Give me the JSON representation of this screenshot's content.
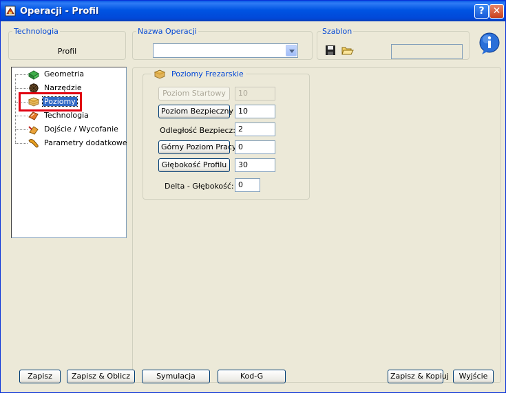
{
  "window": {
    "title": "Operacji - Profil",
    "help_btn": "?",
    "close_btn": "✕"
  },
  "technologia": {
    "legend": "Technologia",
    "value": "Profil"
  },
  "nazwa_operacji": {
    "legend": "Nazwa Operacji",
    "value": ""
  },
  "szablon": {
    "legend": "Szablon",
    "value": ""
  },
  "tree": {
    "items": [
      {
        "label": "Geometria",
        "icon": "geometry-icon"
      },
      {
        "label": "Narzędzie",
        "icon": "tool-icon"
      },
      {
        "label": "Poziomy",
        "icon": "levels-icon",
        "selected": true
      },
      {
        "label": "Technologia",
        "icon": "technology-icon"
      },
      {
        "label": "Dojście / Wycofanie",
        "icon": "approach-icon"
      },
      {
        "label": "Parametry dodatkowe",
        "icon": "params-icon"
      }
    ]
  },
  "poziomy": {
    "title": "Poziomy Frezarskie",
    "poziom_startowy": {
      "label": "Poziom Startowy",
      "value": "10",
      "enabled": false
    },
    "poziom_bezpieczny": {
      "label": "Poziom Bezpieczny",
      "value": "10"
    },
    "odleglosc_bezpiecz": {
      "label": "Odległość Bezpiecz:",
      "value": "2"
    },
    "gorny_poziom": {
      "label": "Górny Poziom Pracy",
      "value": "0"
    },
    "glebokosc": {
      "label": "Głębokość Profilu",
      "value": "30"
    },
    "delta": {
      "label": "Delta - Głębokość:",
      "value": "0"
    }
  },
  "buttons": {
    "zapisz": "Zapisz",
    "zapisz_oblicz": "Zapisz & Oblicz",
    "symulacja": "Symulacja",
    "kod_g": "Kod-G",
    "zapisz_kopiuj": "Zapisz & Kopiuj",
    "wyjscie": "Wyjście"
  },
  "colors": {
    "title_bar": "#0054e3",
    "accent_legend": "#0046d5",
    "selection": "#316ac5",
    "highlight_box": "#e00010"
  }
}
